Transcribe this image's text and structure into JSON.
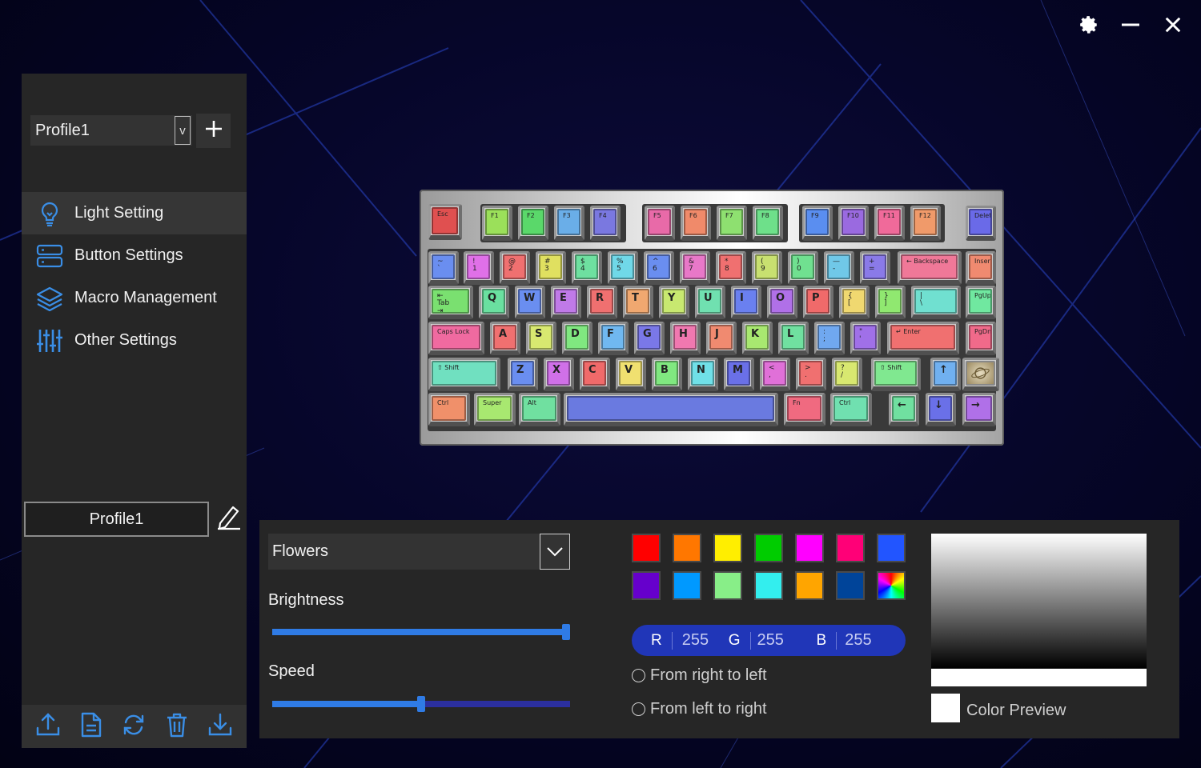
{
  "window": {
    "settings_icon": "gear-icon",
    "minimize_icon": "minimize-icon",
    "close_icon": "close-icon"
  },
  "sidebar": {
    "profile_select": {
      "value": "Profile1",
      "chevron": "v"
    },
    "add_icon": "plus-icon",
    "menu": [
      {
        "label": "Light Setting",
        "icon": "lightbulb-icon",
        "active": true
      },
      {
        "label": "Button Settings",
        "icon": "server-stack-icon",
        "active": false
      },
      {
        "label": "Macro Management",
        "icon": "layers-icon",
        "active": false
      },
      {
        "label": "Other Settings",
        "icon": "sliders-icon",
        "active": false
      }
    ],
    "profile_name": "Profile1",
    "edit_icon": "pencil-icon",
    "bottom_actions": [
      "export-icon",
      "file-icon",
      "sync-icon",
      "trash-icon",
      "import-icon"
    ]
  },
  "keyboard": {
    "keys": [
      {
        "label": "Esc",
        "color": "#e05050"
      },
      {
        "label": "F1",
        "color": "#9be05a"
      },
      {
        "label": "F2",
        "color": "#5ad86a"
      },
      {
        "label": "F3",
        "color": "#6aaee8"
      },
      {
        "label": "F4",
        "color": "#7a78e0"
      },
      {
        "label": "F5",
        "color": "#e86aa8"
      },
      {
        "label": "F6",
        "color": "#f08a6a"
      },
      {
        "label": "F7",
        "color": "#8ee070"
      },
      {
        "label": "F8",
        "color": "#6ee08a"
      },
      {
        "label": "F9",
        "color": "#5a8ef0"
      },
      {
        "label": "F10",
        "color": "#9a6ae0"
      },
      {
        "label": "F11",
        "color": "#f06a9a"
      },
      {
        "label": "F12",
        "color": "#f09a6a"
      },
      {
        "label": "Delete",
        "color": "#6a6ae8"
      },
      {
        "label": "~\n`",
        "color": "#6a8ef0"
      },
      {
        "label": "!\n1",
        "color": "#e070e8"
      },
      {
        "label": "@\n2",
        "color": "#f07070"
      },
      {
        "label": "#\n3",
        "color": "#e0e060"
      },
      {
        "label": "$\n4",
        "color": "#6ee0a0"
      },
      {
        "label": "%\n5",
        "color": "#70d8e8"
      },
      {
        "label": "^\n6",
        "color": "#6a8ef0"
      },
      {
        "label": "&\n7",
        "color": "#e878c8"
      },
      {
        "label": "*\n8",
        "color": "#f07070"
      },
      {
        "label": "(\n9",
        "color": "#c8e070"
      },
      {
        "label": ")\n0",
        "color": "#70e090"
      },
      {
        "label": "—\n-",
        "color": "#70c8e8"
      },
      {
        "label": "+\n=",
        "color": "#8a7ae8"
      },
      {
        "label": "← Backspace",
        "color": "#f07898"
      },
      {
        "label": "Insert",
        "color": "#f08a70"
      },
      {
        "label": "⇤\nTab\n⇥",
        "color": "#7ae070"
      },
      {
        "label": "Q",
        "color": "#6ae0a0"
      },
      {
        "label": "W",
        "color": "#6a8ef0"
      },
      {
        "label": "E",
        "color": "#c07ae8"
      },
      {
        "label": "R",
        "color": "#f07070"
      },
      {
        "label": "T",
        "color": "#f0a870"
      },
      {
        "label": "Y",
        "color": "#c8e870"
      },
      {
        "label": "U",
        "color": "#70e0b0"
      },
      {
        "label": "I",
        "color": "#6a80f0"
      },
      {
        "label": "O",
        "color": "#b070e8"
      },
      {
        "label": "P",
        "color": "#f06a6a"
      },
      {
        "label": "{\n[",
        "color": "#f0d870"
      },
      {
        "label": "}\n]",
        "color": "#90e870"
      },
      {
        "label": "|\n\\",
        "color": "#70e0d0"
      },
      {
        "label": "PgUp",
        "color": "#70e8a0"
      },
      {
        "label": "Caps Lock",
        "color": "#f06aa0"
      },
      {
        "label": "A",
        "color": "#f07070"
      },
      {
        "label": "S",
        "color": "#d8e870"
      },
      {
        "label": "D",
        "color": "#80e880"
      },
      {
        "label": "F",
        "color": "#70b8f0"
      },
      {
        "label": "G",
        "color": "#7a78e8"
      },
      {
        "label": "H",
        "color": "#f078b0"
      },
      {
        "label": "J",
        "color": "#f08a70"
      },
      {
        "label": "K",
        "color": "#a8e870"
      },
      {
        "label": "L",
        "color": "#70e0a0"
      },
      {
        "label": ":\n;",
        "color": "#70a8f0"
      },
      {
        "label": "\"\n'",
        "color": "#a070e8"
      },
      {
        "label": "↵ Enter",
        "color": "#f07070"
      },
      {
        "label": "PgDn",
        "color": "#f06a8a"
      },
      {
        "label": "⇧ Shift",
        "color": "#70e0c0"
      },
      {
        "label": "Z",
        "color": "#6a8ef0"
      },
      {
        "label": "X",
        "color": "#d070e8"
      },
      {
        "label": "C",
        "color": "#f06a6a"
      },
      {
        "label": "V",
        "color": "#f0e070"
      },
      {
        "label": "B",
        "color": "#80e880"
      },
      {
        "label": "N",
        "color": "#70e0e8"
      },
      {
        "label": "M",
        "color": "#6a70e8"
      },
      {
        "label": "<\n,",
        "color": "#e070d8"
      },
      {
        "label": ">\n.",
        "color": "#f07070"
      },
      {
        "label": "?\n/",
        "color": "#d8e870"
      },
      {
        "label": "⇧ Shift",
        "color": "#80e890"
      },
      {
        "label": "↑",
        "color": "#70b0f0"
      },
      {
        "label": "logo",
        "color": "#c8b898"
      },
      {
        "label": "Ctrl",
        "color": "#f0906a"
      },
      {
        "label": "Super",
        "color": "#a8e870"
      },
      {
        "label": "Alt",
        "color": "#70e0a0"
      },
      {
        "label": "",
        "color": "#6a7ae0"
      },
      {
        "label": "Fn",
        "color": "#f06a80"
      },
      {
        "label": "Ctrl",
        "color": "#70e0b0"
      },
      {
        "label": "←",
        "color": "#70e0a0"
      },
      {
        "label": "↓",
        "color": "#6a70e8"
      },
      {
        "label": "→",
        "color": "#b070e8"
      }
    ]
  },
  "panel": {
    "effect": {
      "value": "Flowers",
      "chevron": "chevron-down-icon"
    },
    "brightness": {
      "label": "Brightness",
      "value": 1.0
    },
    "speed": {
      "label": "Speed",
      "value": 0.5
    },
    "swatches": [
      "#ff0000",
      "#ff7700",
      "#ffee00",
      "#00cc00",
      "#ff00ff",
      "#ff0077",
      "#2255ff",
      "#6600cc",
      "#0099ff",
      "#88ee88",
      "#33eeee",
      "#ffa500",
      "#004499",
      "rainbow"
    ],
    "rgb": {
      "r_label": "R",
      "r": "255",
      "g_label": "G",
      "g": "255",
      "b_label": "B",
      "b": "255"
    },
    "direction_options": [
      "From right to left",
      "From left to right"
    ],
    "preview_label": "Color Preview",
    "preview_color": "#ffffff"
  }
}
